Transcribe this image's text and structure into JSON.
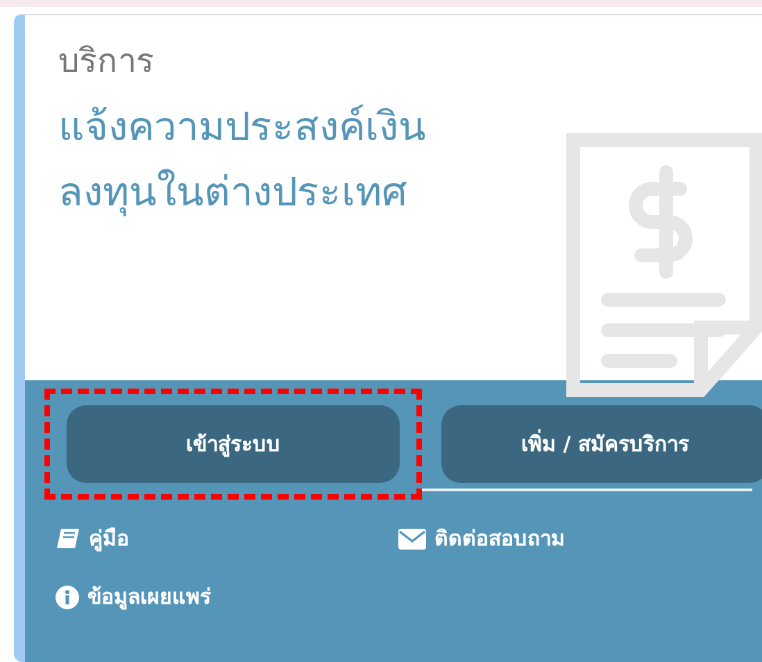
{
  "card": {
    "category": "บริการ",
    "title_lines": [
      "แจ้งความประสงค์เงิน",
      "ลงทุนในต่างประเทศ"
    ]
  },
  "buttons": [
    {
      "label": "เข้าสู่ระบบ",
      "highlighted": true
    },
    {
      "label": "เพิ่ม / สมัครบริการ",
      "highlighted": false
    }
  ],
  "links": [
    {
      "label": "คู่มือ",
      "kind": "book"
    },
    {
      "label": "ติดต่อสอบถาม",
      "kind": "mail"
    },
    {
      "label": "ข้อมูลเผยแพร่",
      "kind": "info"
    }
  ]
}
